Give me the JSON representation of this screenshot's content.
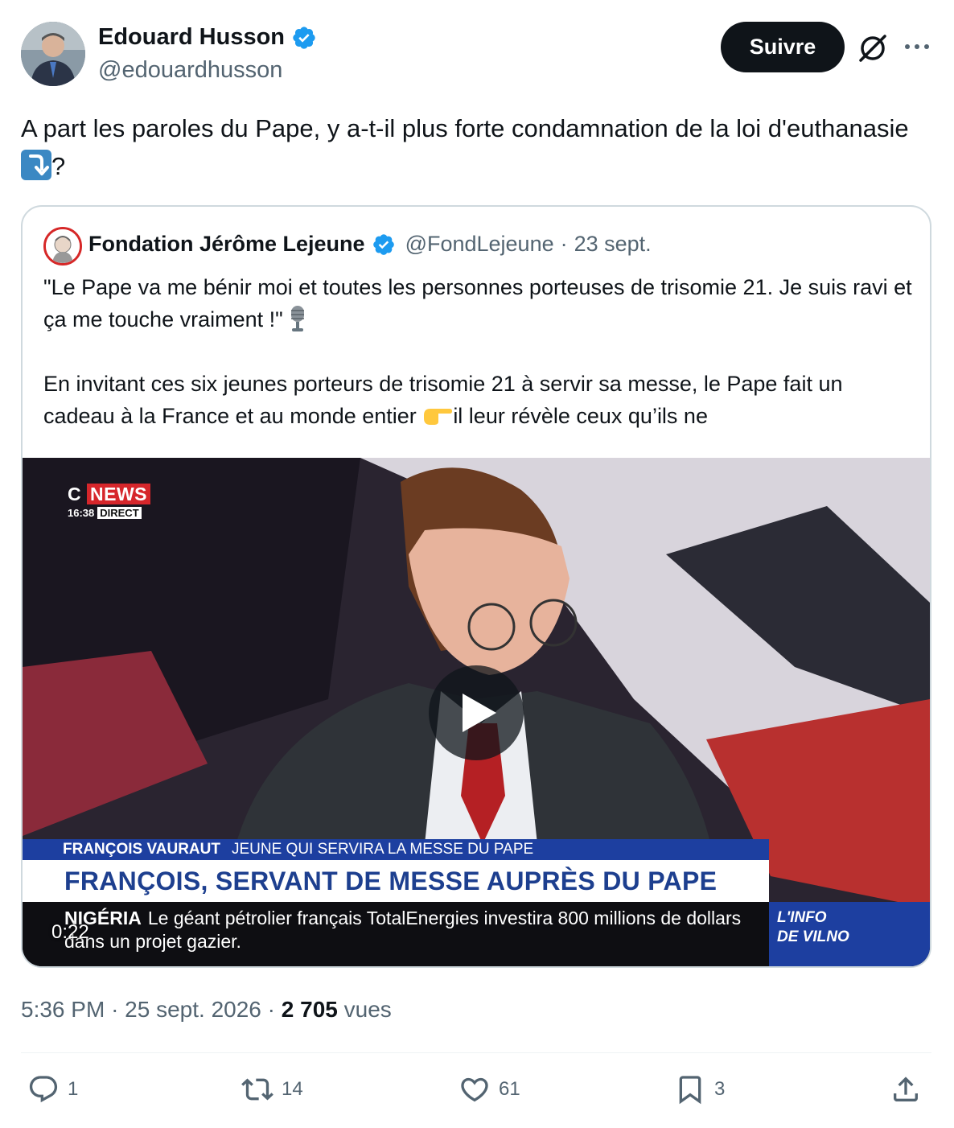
{
  "author": {
    "name": "Edouard Husson",
    "handle": "@edouardhusson"
  },
  "follow_label": "Suivre",
  "tweet": {
    "text": "A part les paroles du Pape, y a-t-il plus forte condamnation de la loi d'euthanasie",
    "text_end": "?"
  },
  "quoted": {
    "name": "Fondation Jérôme Lejeune",
    "handle": "@FondLejeune",
    "separator": "·",
    "date": "23 sept.",
    "para1": "\"Le Pape va me bénir moi et toutes les personnes porteuses de trisomie 21. Je suis ravi et ça me touche vraiment !\"",
    "para2_start": "En invitant ces six jeunes porteurs de trisomie 21 à servir sa messe, le Pape fait un cadeau à la France et au monde entier ",
    "para2_end": "il leur révèle ceux qu’ils ne"
  },
  "video": {
    "duration": "0:22",
    "channel": {
      "c": "C",
      "news": "NEWS",
      "time": "16:38",
      "live": "DIRECT"
    },
    "lower_name": "FRANÇOIS VAURAUT",
    "lower_role": "JEUNE QUI SERVIRA LA MESSE DU PAPE",
    "headline": "FRANÇOIS, SERVANT DE MESSE AUPRÈS DU PAPE",
    "ticker_tag": "NIGÉRIA",
    "ticker_text": "Le géant pétrolier français TotalEnergies investira 800 millions de dollars dans un projet gazier.",
    "side_line1": "L'INFO",
    "side_line2": "DE VILNO"
  },
  "meta": {
    "time": "5:36 PM",
    "dot1": "·",
    "date": "25 sept. 2026",
    "dot2": "·",
    "views_count": "2 705",
    "views_label": "vues"
  },
  "actions": {
    "replies": "1",
    "reposts": "14",
    "likes": "61",
    "bookmarks": "3"
  },
  "colors": {
    "verified": "#1d9bf0",
    "text": "#0f1419",
    "secondary": "#536471",
    "border": "#cfd9de",
    "cnews_blue": "#1d3fa0",
    "cnews_red": "#d6262b"
  },
  "icons": [
    "verified-badge-icon",
    "grok-icon",
    "more-icon",
    "arrow-down-right-emoji",
    "microphone-emoji",
    "pointing-finger-emoji",
    "play-icon",
    "reply-icon",
    "repost-icon",
    "like-icon",
    "bookmark-icon",
    "share-icon"
  ]
}
